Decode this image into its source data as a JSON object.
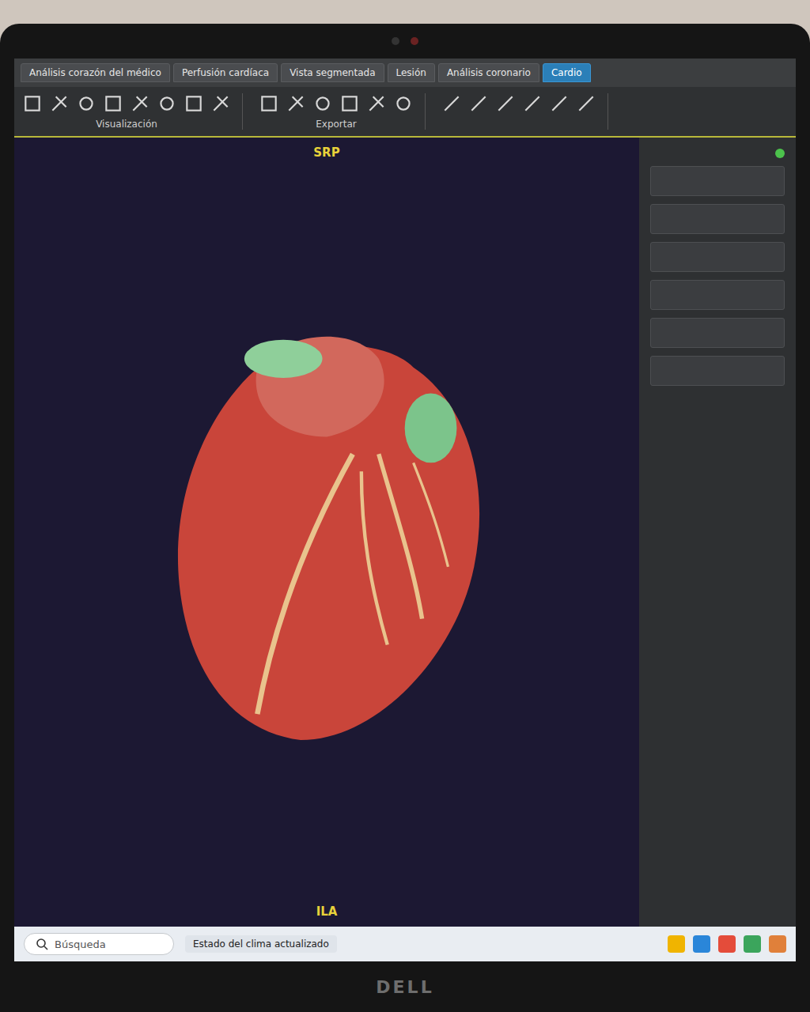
{
  "tabs": [
    {
      "label": "Análisis corazón del médico",
      "selected": false
    },
    {
      "label": "Perfusión cardíaca",
      "selected": false
    },
    {
      "label": "Vista segmentada",
      "selected": false
    },
    {
      "label": "Lesión",
      "selected": false
    },
    {
      "label": "Análisis coronario",
      "selected": false
    },
    {
      "label": "Cardio",
      "selected": true
    }
  ],
  "ribbon_groups": [
    {
      "label": "Visualización"
    },
    {
      "label": "Exportar"
    }
  ],
  "viewport": {
    "orientation_top": "SRP",
    "orientation_bottom": "ILA"
  },
  "taskbar": {
    "search_placeholder": "Búsqueda",
    "notification": "Estado del clima actualizado"
  },
  "laptop": {
    "brand": "DELL"
  }
}
